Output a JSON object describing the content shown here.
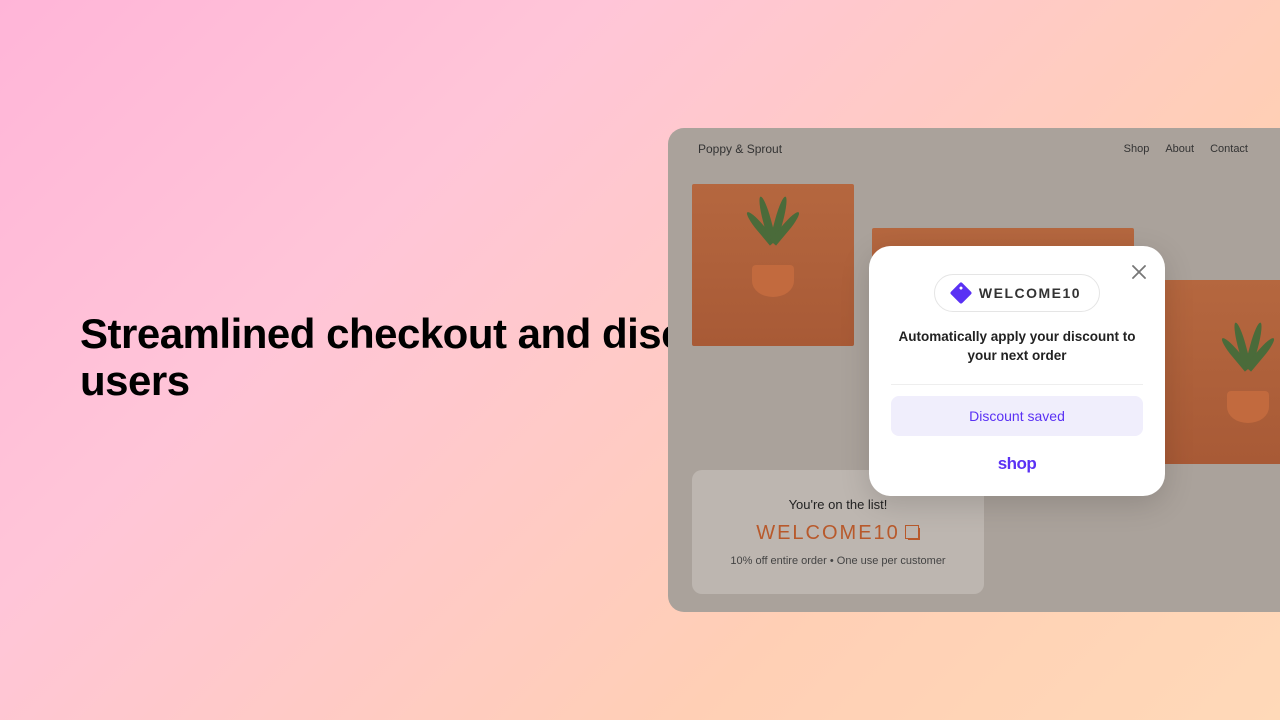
{
  "headline": "Streamlined checkout and discount experience for Shop users",
  "store": {
    "brand": "Poppy & Sprout",
    "nav": {
      "shop": "Shop",
      "about": "About",
      "contact": "Contact"
    }
  },
  "promo": {
    "title": "You're on the list!",
    "code": "WELCOME10",
    "sub": "10% off entire order • One use per customer"
  },
  "popup": {
    "code": "WELCOME10",
    "message": "Automatically apply your discount to your next order",
    "button": "Discount saved",
    "logo": "shop"
  },
  "colors": {
    "accent": "#5a31f4",
    "promo_code": "#b8592b"
  }
}
